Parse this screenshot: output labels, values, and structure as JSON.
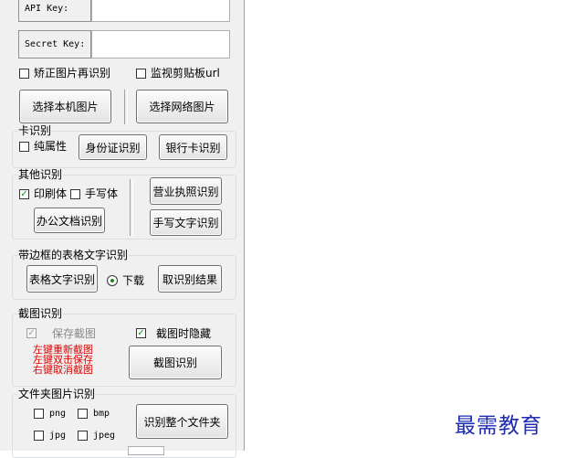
{
  "api": {
    "api_key_label": "API Key:",
    "api_key_value": "",
    "secret_key_label": "Secret Key:",
    "secret_key_value": ""
  },
  "options": {
    "correct_image_label": "矫正图片再识别",
    "correct_image_checked": false,
    "monitor_clipboard_label": "监视剪贴板url",
    "monitor_clipboard_checked": false
  },
  "image_source": {
    "local_button": "选择本机图片",
    "network_button": "选择网络图片"
  },
  "card_group": {
    "title": "卡识别",
    "pure_attr_label": "纯属性",
    "pure_attr_checked": false,
    "id_card_button": "身份证识别",
    "bank_card_button": "银行卡识别"
  },
  "other_group": {
    "title": "其他识别",
    "print_label": "印刷体",
    "print_checked": true,
    "handwrite_label": "手写体",
    "handwrite_checked": false,
    "office_doc_button": "办公文档识别",
    "business_license_button": "营业执照识别",
    "handwriting_button": "手写文字识别"
  },
  "table_group": {
    "title": "带边框的表格文字识别",
    "table_button": "表格文字识别",
    "download_label": "下载",
    "download_selected": true,
    "result_button": "取识别结果"
  },
  "screenshot_group": {
    "title": "截图识别",
    "save_label": "保存截图",
    "save_checked": true,
    "save_disabled": true,
    "hide_label": "截图时隐藏",
    "hide_checked": true,
    "hint_lines": [
      "左键重新截图",
      "左键双击保存",
      "右键取消截图"
    ],
    "screenshot_button": "截图识别"
  },
  "folder_group": {
    "title": "文件夹图片识别",
    "formats": [
      {
        "label": "png",
        "checked": false
      },
      {
        "label": "bmp",
        "checked": false
      },
      {
        "label": "jpg",
        "checked": false
      },
      {
        "label": "jpeg",
        "checked": false
      }
    ],
    "folder_button": "识别整个文件夹"
  },
  "watermark": "最需教育",
  "colors": {
    "check_green": "#1b8a1b",
    "hint_red": "#e00000",
    "watermark_blue": "#1d2bb0"
  }
}
